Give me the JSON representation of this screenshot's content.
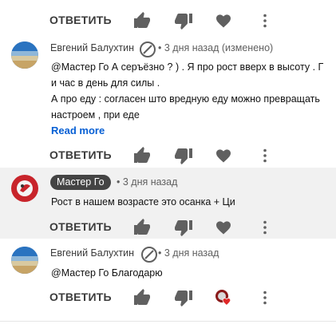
{
  "colors": {
    "link": "#065fd4",
    "highlight": "#f1f1f1",
    "heart_red": "#e02828"
  },
  "top": {
    "reply_label": "ОТВЕТИТЬ"
  },
  "comment1": {
    "author": "Евгений Балухтин",
    "time": "3 дня назад (изменено)",
    "line1": "@Мастер Го  А серъёзно ? ) . Я про рост вверх в высоту . Г",
    "line2": "и час в день для силы .",
    "line3": "А про еду : согласен што вредную еду можно превращать",
    "line4": "настроем , при еде",
    "read_more": "Read more",
    "reply_label": "ОТВЕТИТЬ"
  },
  "comment2": {
    "author": "Мастер Го",
    "time": "3 дня назад",
    "text": "Рост в нашем возрасте это осанка + Ци",
    "reply_label": "ОТВЕТИТЬ"
  },
  "comment3": {
    "author": "Евгений Балухтин",
    "time": "3 дня назад",
    "text": "@Мастер Го  Благодарю",
    "reply_label": "ОТВЕТИТЬ"
  },
  "icons": [
    "like-icon",
    "dislike-icon",
    "heart-icon",
    "more-vert-icon",
    "verified-icon",
    "creator-heart-icon"
  ]
}
